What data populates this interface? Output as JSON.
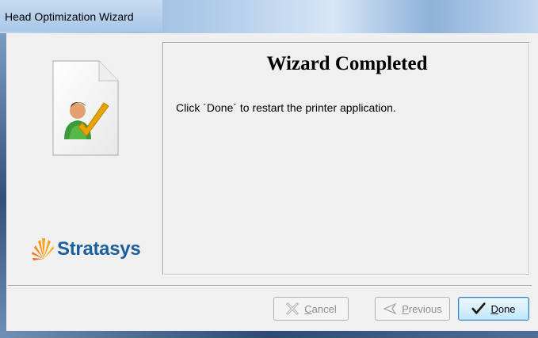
{
  "window": {
    "title": "Head Optimization Wizard"
  },
  "sidebar": {
    "logo_text": "Stratasys",
    "icon": "user-check-document-icon"
  },
  "content": {
    "heading": "Wizard Completed",
    "message": "Click ´Done´ to restart the printer application."
  },
  "buttons": {
    "cancel_label": "Cancel",
    "previous_label": "Previous",
    "done_label": "Done"
  },
  "colors": {
    "brand_blue": "#1c5f9c",
    "brand_orange": "#f7a41d",
    "check_orange": "#e8a400"
  }
}
